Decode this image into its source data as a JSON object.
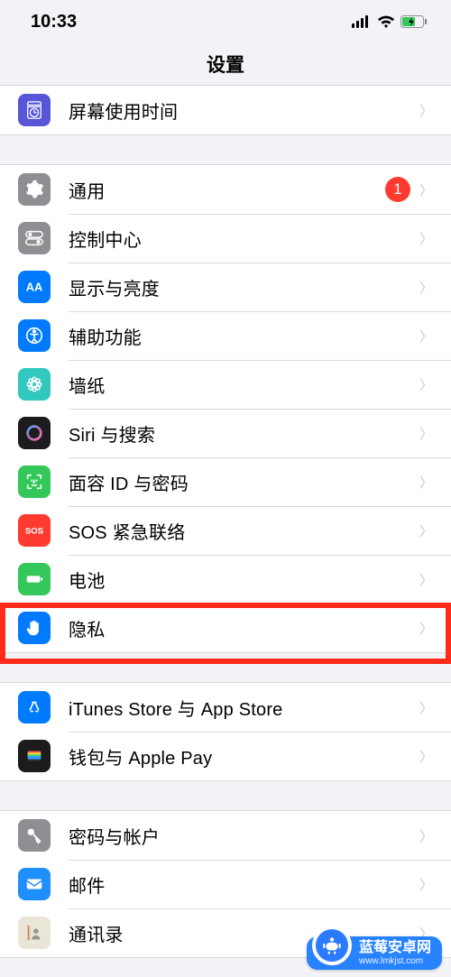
{
  "status": {
    "time": "10:33"
  },
  "title": "设置",
  "group1": {
    "screentime": "屏幕使用时间"
  },
  "group2": {
    "general": "通用",
    "general_badge": "1",
    "control": "控制中心",
    "display": "显示与亮度",
    "accessibility": "辅助功能",
    "wallpaper": "墙纸",
    "siri": "Siri 与搜索",
    "faceid": "面容 ID 与密码",
    "sos": "SOS 紧急联络",
    "battery": "电池",
    "privacy": "隐私"
  },
  "group3": {
    "itunes": "iTunes Store 与 App Store",
    "wallet": "钱包与 Apple Pay"
  },
  "group4": {
    "passwords": "密码与帐户",
    "mail": "邮件",
    "contacts": "通讯录"
  },
  "watermark": {
    "title": "蓝莓安卓网",
    "url": "www.lmkjst.com"
  }
}
